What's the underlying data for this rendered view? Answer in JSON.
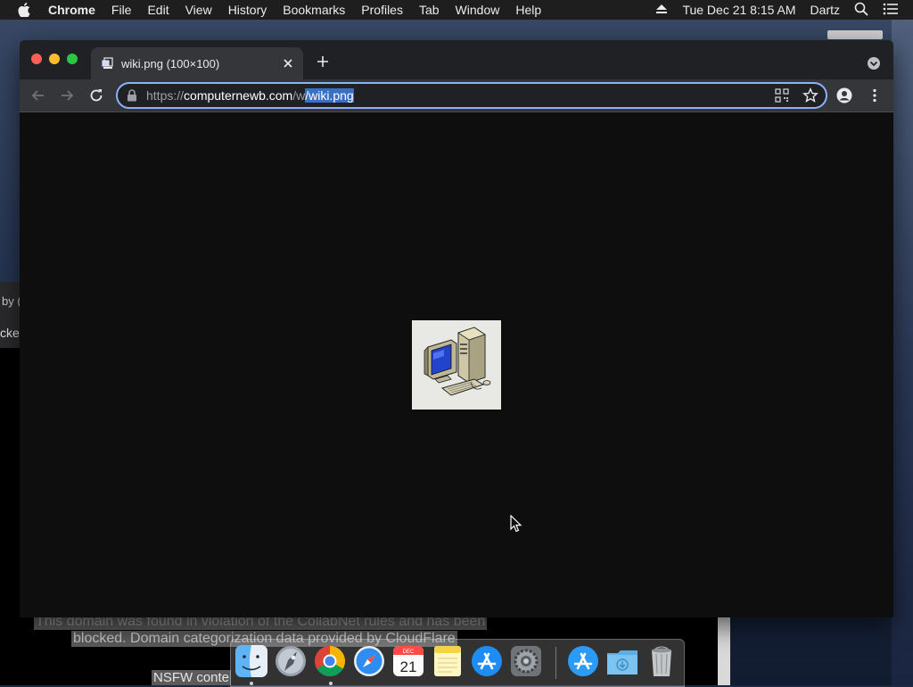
{
  "menubar": {
    "app_name": "Chrome",
    "items": [
      "File",
      "Edit",
      "View",
      "History",
      "Bookmarks",
      "Profiles",
      "Tab",
      "Window",
      "Help"
    ],
    "datetime": "Tue Dec 21  8:15 AM",
    "user": "Dartz"
  },
  "browser": {
    "tab": {
      "title": "wiki.png (100×100)"
    },
    "address": {
      "scheme": "https://",
      "domain": "computernewb.com",
      "path_prefix": "/w",
      "path_selected": "/wiki.png"
    }
  },
  "background": {
    "fragment_1": "by (",
    "fragment_2": "cke",
    "notice_line_1": "This domain was found in violation of the CollabNet rules and has been",
    "notice_line_2": "blocked. Domain categorization data provided by CloudFlare",
    "notice_line_3": "NSFW conte"
  },
  "dock": {
    "apps": [
      "finder-icon",
      "launchpad-icon",
      "chrome-icon",
      "safari-icon",
      "calendar-icon",
      "notes-icon",
      "app-store-icon",
      "system-preferences-icon",
      "app-store-icon",
      "downloads-folder-icon",
      "trash-icon"
    ],
    "calendar_month": "DEC",
    "calendar_day": "21"
  },
  "colors": {
    "focus_ring": "#8ab4f8",
    "selection": "#3b6fc4"
  }
}
